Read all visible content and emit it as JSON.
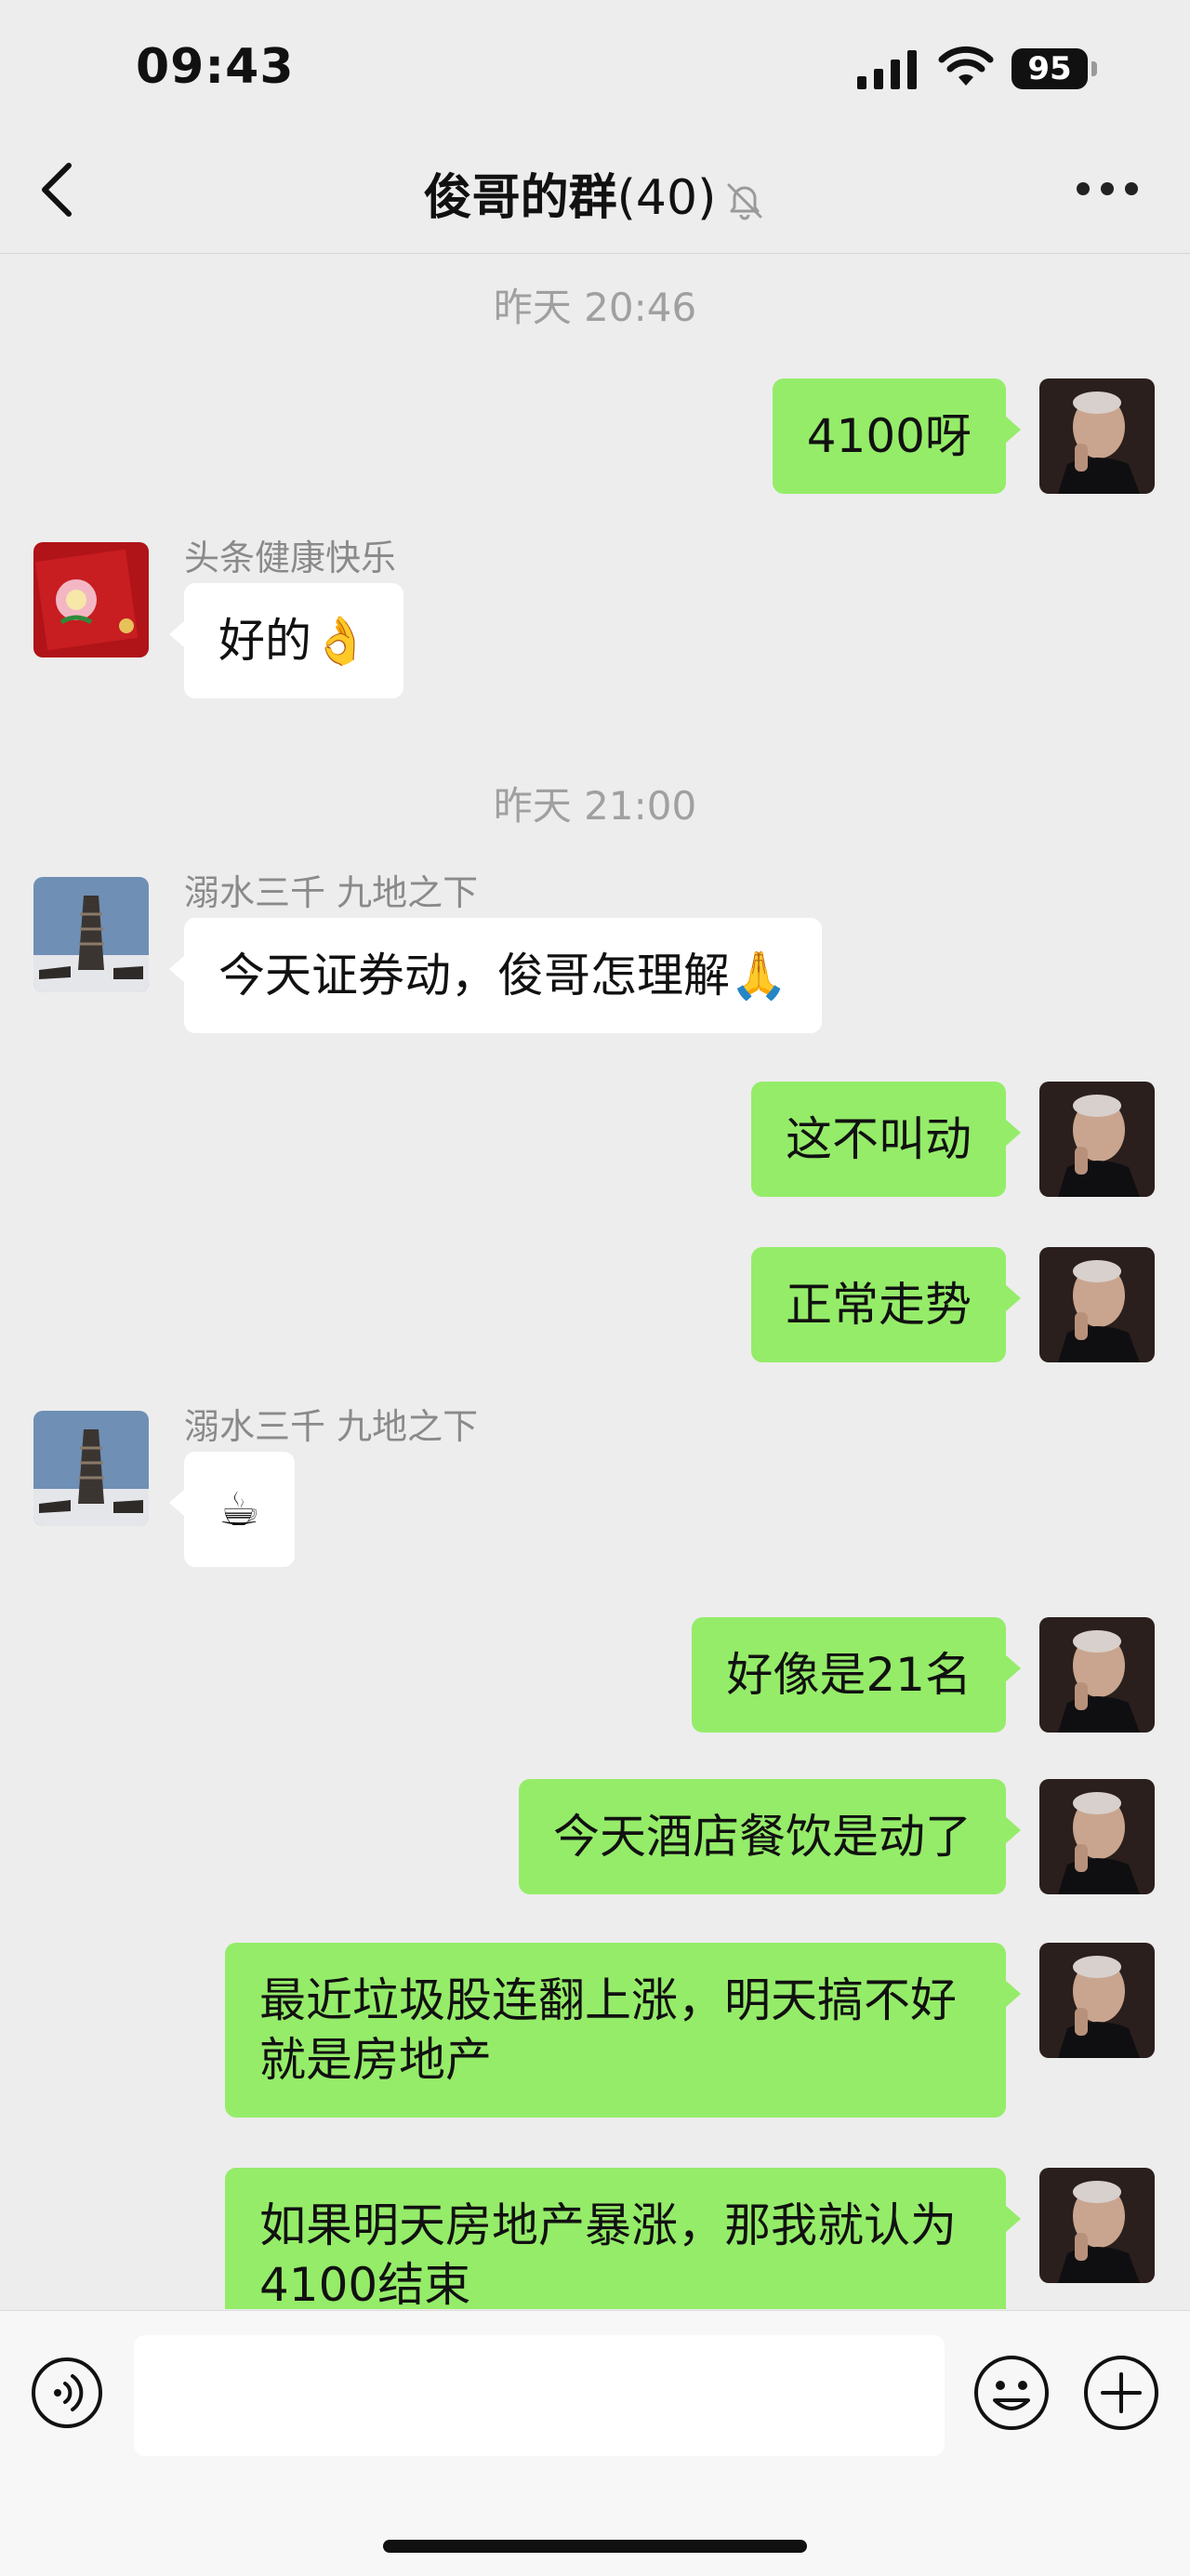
{
  "status_bar": {
    "time": "09:43",
    "battery": "95"
  },
  "header": {
    "title": "俊哥的群",
    "member_count": "(40)"
  },
  "messages": [
    {
      "kind": "timestamp",
      "text": "昨天 20:46"
    },
    {
      "kind": "out",
      "text": "4100呀"
    },
    {
      "kind": "in",
      "sender": "头条健康快乐",
      "text": "好的👌"
    },
    {
      "kind": "timestamp",
      "text": "昨天 21:00"
    },
    {
      "kind": "in",
      "sender": "溺水三千 九地之下",
      "text": "今天证券动，俊哥怎理解🙏"
    },
    {
      "kind": "out",
      "text": "这不叫动"
    },
    {
      "kind": "out",
      "text": "正常走势"
    },
    {
      "kind": "in",
      "sender": "溺水三千 九地之下",
      "text": "☕"
    },
    {
      "kind": "out",
      "text": "好像是21名"
    },
    {
      "kind": "out",
      "text": "今天酒店餐饮是动了"
    },
    {
      "kind": "out",
      "text": "最近垃圾股连翻上涨，明天搞不好就是房地产"
    },
    {
      "kind": "out",
      "text": "如果明天房地产暴涨，那我就认为4100结束"
    }
  ],
  "input": {
    "value": ""
  },
  "colors": {
    "outgoing_bubble": "#95ec69",
    "incoming_bubble": "#ffffff",
    "background": "#ededed"
  }
}
